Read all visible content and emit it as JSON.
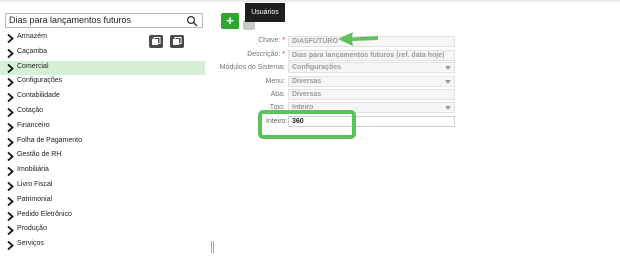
{
  "search": {
    "value": "Dias para lançamentos futuros"
  },
  "tree": {
    "items": [
      {
        "label": "Armazém",
        "selected": false
      },
      {
        "label": "Caçamba",
        "selected": false
      },
      {
        "label": "Comercial",
        "selected": true
      },
      {
        "label": "Configurações",
        "selected": false
      },
      {
        "label": "Contabilidade",
        "selected": false
      },
      {
        "label": "Cotação",
        "selected": false
      },
      {
        "label": "Financeiro",
        "selected": false
      },
      {
        "label": "Folha de Pagamento",
        "selected": false
      },
      {
        "label": "Gestão de RH",
        "selected": false
      },
      {
        "label": "Imobiliária",
        "selected": false
      },
      {
        "label": "Livro Fiscal",
        "selected": false
      },
      {
        "label": "Patrimonial",
        "selected": false
      },
      {
        "label": "Pedido Eletrônico",
        "selected": false
      },
      {
        "label": "Produção",
        "selected": false
      },
      {
        "label": "Serviços",
        "selected": false
      }
    ]
  },
  "toolbar": {
    "add_label": "+",
    "tooltip": "Usuários"
  },
  "form": {
    "chave": {
      "label": "Chave:",
      "required": "*",
      "value": "DIASFUTURO"
    },
    "descricao": {
      "label": "Descrição:",
      "required": "*",
      "value": "Dias para lançamentos futuros (ref. data hoje)"
    },
    "modulos": {
      "label": "Módulos do Sistema:",
      "value": "Configurações"
    },
    "menu": {
      "label": "Menu:",
      "value": "Diversas"
    },
    "aba": {
      "label": "Aba:",
      "value": "Diversas"
    },
    "tipo": {
      "label": "Tipo:",
      "value": "Inteiro"
    },
    "inteiro": {
      "label": "Inteiro:",
      "value": "360"
    }
  },
  "colors": {
    "accent_green": "#5dc25b",
    "selected_row": "#d5f0d3",
    "add_button": "#2fa82f"
  }
}
